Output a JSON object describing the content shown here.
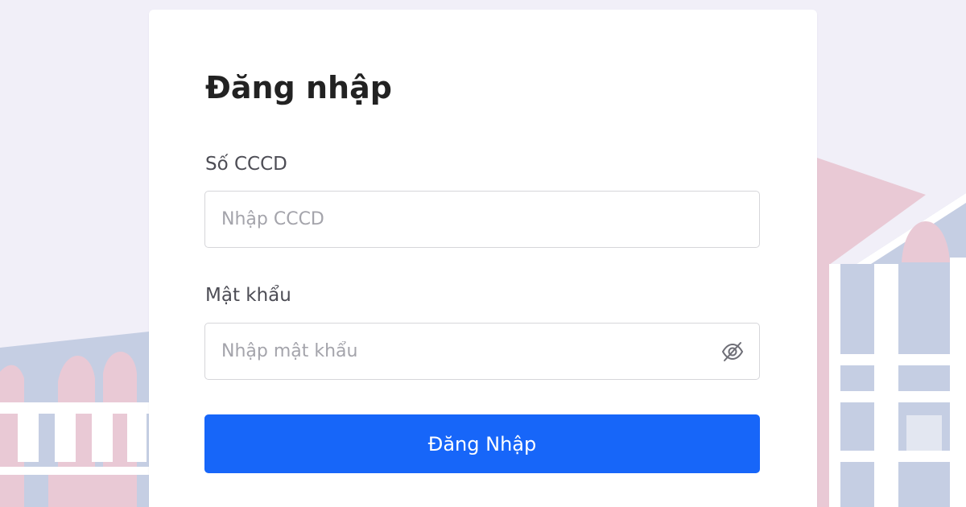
{
  "login_form": {
    "title": "Đăng nhập",
    "cccd_label": "Số CCCD",
    "cccd_placeholder": "Nhập CCCD",
    "cccd_value": "",
    "password_label": "Mật khẩu",
    "password_placeholder": "Nhập mật khẩu",
    "password_value": "",
    "submit_label": "Đăng Nhập"
  },
  "icons": {
    "password_toggle": "eye-off-icon"
  },
  "colors": {
    "page_background": "#f1eff8",
    "card_background": "#ffffff",
    "accent": "#1766f9",
    "illustration_pink": "#e9c9d5",
    "illustration_blue": "#c5cee3"
  }
}
